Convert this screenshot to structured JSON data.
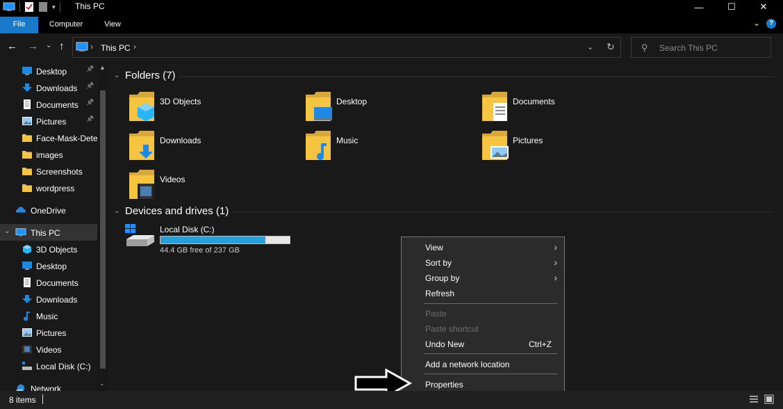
{
  "window": {
    "title": "This PC",
    "minimize": "—",
    "maximize": "☐",
    "close": "✕"
  },
  "ribbon": {
    "tabs": [
      "File",
      "Computer",
      "View"
    ],
    "help": "?"
  },
  "address": {
    "crumb": "This PC",
    "search_placeholder": "Search This PC"
  },
  "nav": {
    "quick_access": [
      {
        "label": "Desktop",
        "icon": "desktop-icon",
        "pinned": true
      },
      {
        "label": "Downloads",
        "icon": "downloads-icon",
        "pinned": true
      },
      {
        "label": "Documents",
        "icon": "documents-icon",
        "pinned": true
      },
      {
        "label": "Pictures",
        "icon": "pictures-icon",
        "pinned": true
      },
      {
        "label": "Face-Mask-Dete",
        "icon": "folder-icon",
        "pinned": false
      },
      {
        "label": "images",
        "icon": "folder-icon",
        "pinned": false
      },
      {
        "label": "Screenshots",
        "icon": "folder-icon",
        "pinned": false
      },
      {
        "label": "wordpress",
        "icon": "folder-icon",
        "pinned": false
      }
    ],
    "onedrive": "OneDrive",
    "this_pc": "This PC",
    "this_pc_children": [
      {
        "label": "3D Objects",
        "icon": "3d-objects-icon"
      },
      {
        "label": "Desktop",
        "icon": "desktop-icon"
      },
      {
        "label": "Documents",
        "icon": "documents-icon"
      },
      {
        "label": "Downloads",
        "icon": "downloads-icon"
      },
      {
        "label": "Music",
        "icon": "music-icon"
      },
      {
        "label": "Pictures",
        "icon": "pictures-icon"
      },
      {
        "label": "Videos",
        "icon": "videos-icon"
      },
      {
        "label": "Local Disk (C:)",
        "icon": "drive-icon"
      }
    ],
    "network": "Network"
  },
  "content": {
    "folders_header": "Folders (7)",
    "folders": [
      {
        "label": "3D Objects",
        "icon": "3d-objects-icon"
      },
      {
        "label": "Desktop",
        "icon": "desktop-icon"
      },
      {
        "label": "Documents",
        "icon": "documents-icon"
      },
      {
        "label": "Downloads",
        "icon": "downloads-icon"
      },
      {
        "label": "Music",
        "icon": "music-icon"
      },
      {
        "label": "Pictures",
        "icon": "pictures-icon"
      },
      {
        "label": "Videos",
        "icon": "videos-icon"
      }
    ],
    "drives_header": "Devices and drives (1)",
    "drive": {
      "name": "Local Disk (C:)",
      "free_text": "44.4 GB free of 237 GB",
      "used_fraction": 0.81
    }
  },
  "context_menu": {
    "items": [
      {
        "label": "View",
        "submenu": true,
        "disabled": false
      },
      {
        "label": "Sort by",
        "submenu": true,
        "disabled": false
      },
      {
        "label": "Group by",
        "submenu": true,
        "disabled": false
      },
      {
        "label": "Refresh",
        "submenu": false,
        "disabled": false
      },
      {
        "label": "Paste",
        "submenu": false,
        "disabled": true
      },
      {
        "label": "Paste shortcut",
        "submenu": false,
        "disabled": true
      },
      {
        "label": "Undo New",
        "submenu": false,
        "disabled": false,
        "shortcut": "Ctrl+Z"
      },
      {
        "label": "Add a network location",
        "submenu": false,
        "disabled": false
      },
      {
        "label": "Properties",
        "submenu": false,
        "disabled": false
      }
    ]
  },
  "status": {
    "item_count": "8 items"
  },
  "colors": {
    "accent": "#1979ca",
    "drive_bar": "#26a0da",
    "folder_yellow": "#f5c542"
  }
}
